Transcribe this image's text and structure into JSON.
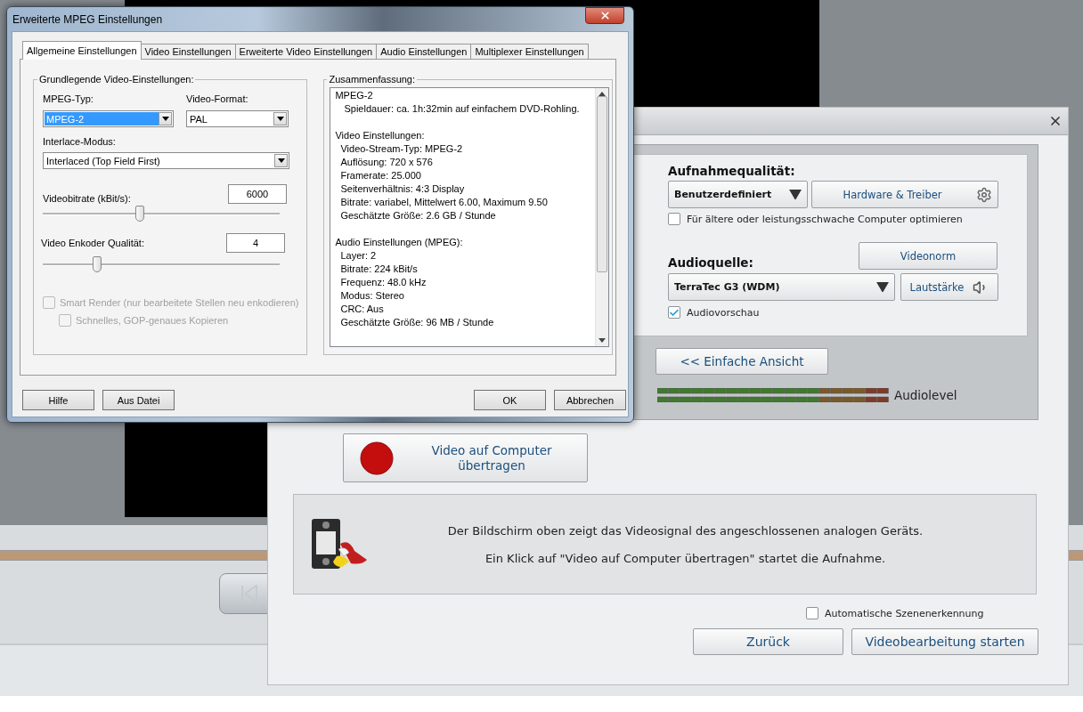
{
  "capture_dialog": {
    "recording_quality": {
      "label": "Aufnahmequalität:",
      "dropdown": {
        "value": "Benutzerdefiniert"
      },
      "hardware_button": "Hardware & Treiber",
      "optimize_checkbox": {
        "label": "Für ältere oder leistungsschwache Computer optimieren",
        "checked": false
      }
    },
    "video_norm_button": "Videonorm",
    "audio_source": {
      "label": "Audioquelle:",
      "dropdown": {
        "value": "TerraTec G3 (WDM)"
      },
      "volume_button": "Lautstärke",
      "preview_checkbox": {
        "label": "Audiovorschau",
        "checked": true
      }
    },
    "simple_view_button": "<< Einfache Ansicht",
    "audio_level_label": "Audiolevel",
    "record_button": "Video auf Computer übertragen",
    "info": [
      "Der Bildschirm oben zeigt das Videosignal des angeschlossenen analogen Geräts.",
      "Ein Klick auf \"Video auf Computer übertragen\" startet die Aufnahme."
    ],
    "scene_detection": {
      "label": "Automatische Szenenerkennung",
      "checked": false
    },
    "buttons": [
      "Zurück",
      "Videobearbeitung starten"
    ]
  },
  "mpeg_dialog": {
    "title": "Erweiterte MPEG Einstellungen",
    "tabs": [
      {
        "label": "Allgemeine Einstellungen",
        "selected": true
      },
      {
        "label": "Video Einstellungen",
        "selected": false
      },
      {
        "label": "Erweiterte Video Einstellungen",
        "selected": false
      },
      {
        "label": "Audio Einstellungen",
        "selected": false
      },
      {
        "label": "Multiplexer Einstellungen",
        "selected": false
      }
    ],
    "basic_group": {
      "title": "Grundlegende Video-Einstellungen:",
      "mpeg_type": {
        "label": "MPEG-Typ:",
        "value": "MPEG-2",
        "highlighted": true
      },
      "video_format": {
        "label": "Video-Format:",
        "value": "PAL",
        "highlighted": false
      },
      "interlace_mode": {
        "label": "Interlace-Modus:",
        "value": "Interlaced (Top Field First)",
        "highlighted": false
      },
      "bitrate": {
        "label": "Videobitrate (kBit/s):",
        "value": "6000",
        "level": 0.41
      },
      "quality": {
        "label": "Video Enkoder Qualität:",
        "value": "4",
        "level": 0.23
      },
      "smart_render": {
        "label": "Smart Render (nur bearbeitete Stellen neu enkodieren)",
        "checked": false,
        "disabled": true
      },
      "fast_copy": {
        "label": "Schnelles, GOP-genaues Kopieren",
        "checked": false,
        "disabled": true
      }
    },
    "summary": {
      "title": "Zusammenfassung:",
      "lines": [
        {
          "text": "MPEG-2",
          "children": [
            {
              "text": "Spieldauer: ca. 1h:32min auf einfachem DVD-Rohling."
            }
          ]
        },
        {
          "text": "Video Einstellungen:",
          "children": [
            {
              "text": "Video-Stream-Typ: MPEG-2"
            },
            {
              "text": "Auflösung: 720 x 576"
            },
            {
              "text": "Framerate: 25.000"
            },
            {
              "text": "Seitenverhältnis: 4:3 Display"
            },
            {
              "text": "Bitrate: variabel, Mittelwert 6.00, Maximum 9.50"
            },
            {
              "text": "Geschätzte Größe: 2.6 GB / Stunde"
            }
          ]
        },
        {
          "text": "Audio Einstellungen (MPEG):",
          "children": [
            {
              "text": "Layer: 2"
            },
            {
              "text": "Bitrate: 224 kBit/s"
            },
            {
              "text": "Frequenz: 48.0 kHz"
            },
            {
              "text": "Modus: Stereo"
            },
            {
              "text": "CRC: Aus"
            },
            {
              "text": "Geschätzte Größe: 96 MB / Stunde"
            }
          ]
        }
      ]
    },
    "left_buttons": [
      "Hilfe",
      "Aus Datei"
    ],
    "right_buttons": [
      "OK",
      "Abbrechen"
    ]
  }
}
